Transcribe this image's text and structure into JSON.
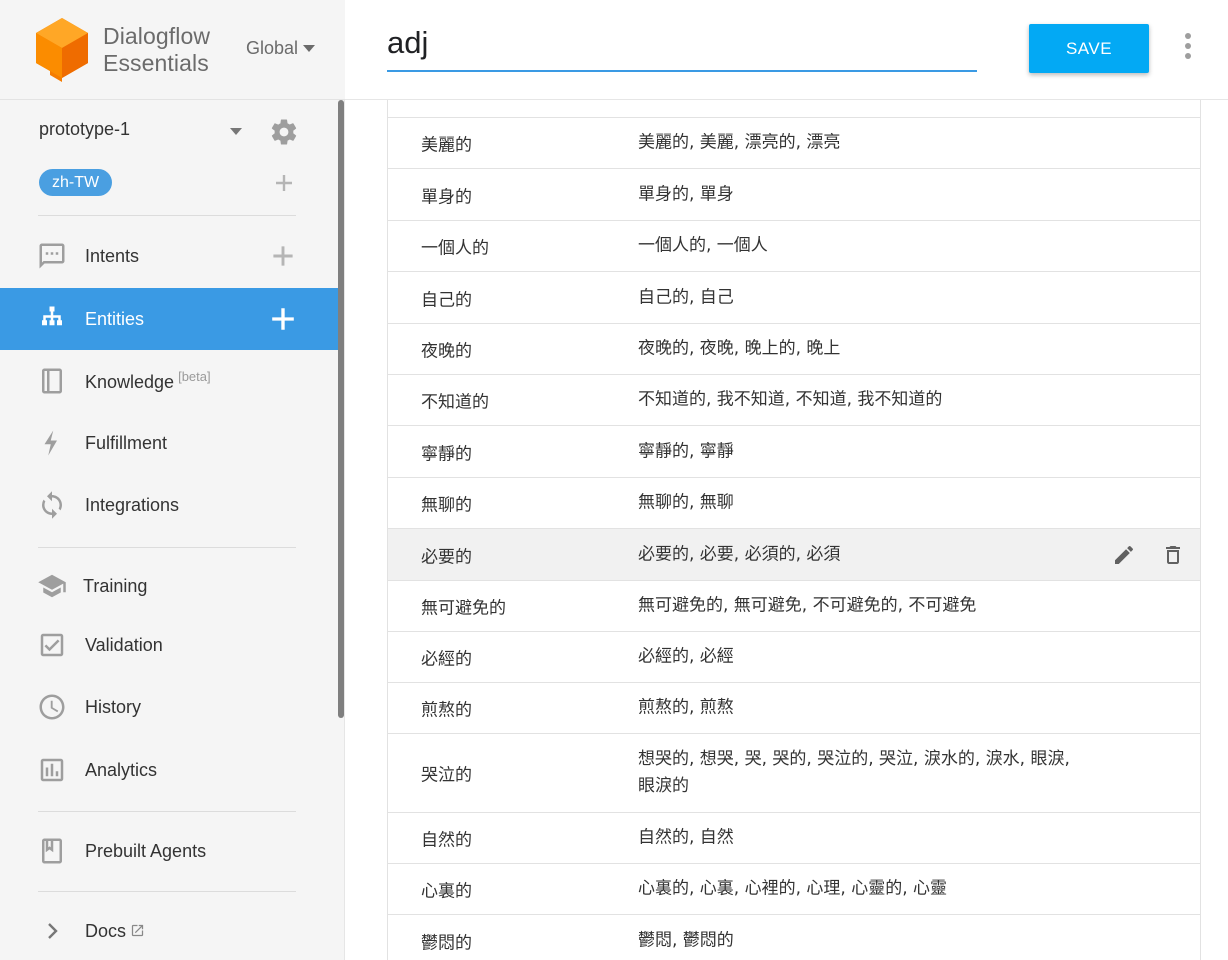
{
  "brand": {
    "line1": "Dialogflow",
    "line2": "Essentials",
    "region": "Global"
  },
  "agent": {
    "name": "prototype-1",
    "language": "zh-TW"
  },
  "nav": [
    {
      "label": "Intents",
      "icon": "chat-bubble-icon",
      "active": false,
      "has_add": true
    },
    {
      "label": "Entities",
      "icon": "sitemap-icon",
      "active": true,
      "has_add": true
    },
    {
      "label": "Knowledge",
      "badge": "[beta]",
      "icon": "book-icon",
      "active": false
    },
    {
      "label": "Fulfillment",
      "icon": "lightning-icon",
      "active": false
    },
    {
      "label": "Integrations",
      "icon": "sync-icon",
      "active": false
    },
    {
      "label": "Training",
      "icon": "graduation-cap-icon",
      "active": false
    },
    {
      "label": "Validation",
      "icon": "checkbox-icon",
      "active": false
    },
    {
      "label": "History",
      "icon": "clock-icon",
      "active": false
    },
    {
      "label": "Analytics",
      "icon": "bar-chart-icon",
      "active": false
    },
    {
      "label": "Prebuilt Agents",
      "icon": "bookmark-book-icon",
      "active": false
    },
    {
      "label": "Docs",
      "icon": "chevron-right-icon",
      "active": false,
      "external": true
    }
  ],
  "entity": {
    "name": "adj"
  },
  "toolbar": {
    "save_label": "SAVE"
  },
  "entries": [
    {
      "ref": "美麗的",
      "synonyms": "美麗的, 美麗, 漂亮的, 漂亮"
    },
    {
      "ref": "單身的",
      "synonyms": "單身的, 單身"
    },
    {
      "ref": "一個人的",
      "synonyms": "一個人的, 一個人"
    },
    {
      "ref": "自己的",
      "synonyms": "自己的, 自己"
    },
    {
      "ref": "夜晚的",
      "synonyms": "夜晚的, 夜晚, 晚上的, 晚上"
    },
    {
      "ref": "不知道的",
      "synonyms": "不知道的, 我不知道, 不知道, 我不知道的"
    },
    {
      "ref": "寧靜的",
      "synonyms": "寧靜的, 寧靜"
    },
    {
      "ref": "無聊的",
      "synonyms": "無聊的, 無聊"
    },
    {
      "ref": "必要的",
      "synonyms": "必要的, 必要, 必須的, 必須"
    },
    {
      "ref": "無可避免的",
      "synonyms": "無可避免的, 無可避免, 不可避免的, 不可避免"
    },
    {
      "ref": "必經的",
      "synonyms": "必經的, 必經"
    },
    {
      "ref": "煎熬的",
      "synonyms": "煎熬的, 煎熬"
    },
    {
      "ref": "哭泣的",
      "synonyms": "想哭的, 想哭, 哭, 哭的, 哭泣的, 哭泣, 淚水的, 淚水, 眼淚, 眼淚的"
    },
    {
      "ref": "自然的",
      "synonyms": "自然的, 自然"
    },
    {
      "ref": "心裏的",
      "synonyms": "心裏的, 心裏, 心裡的, 心理, 心靈的, 心靈"
    },
    {
      "ref": "鬱悶的",
      "synonyms": "鬱悶, 鬱悶的"
    }
  ],
  "colors": {
    "accent": "#3a9ae4",
    "save": "#03a9f4",
    "logo": "#ff9800"
  }
}
